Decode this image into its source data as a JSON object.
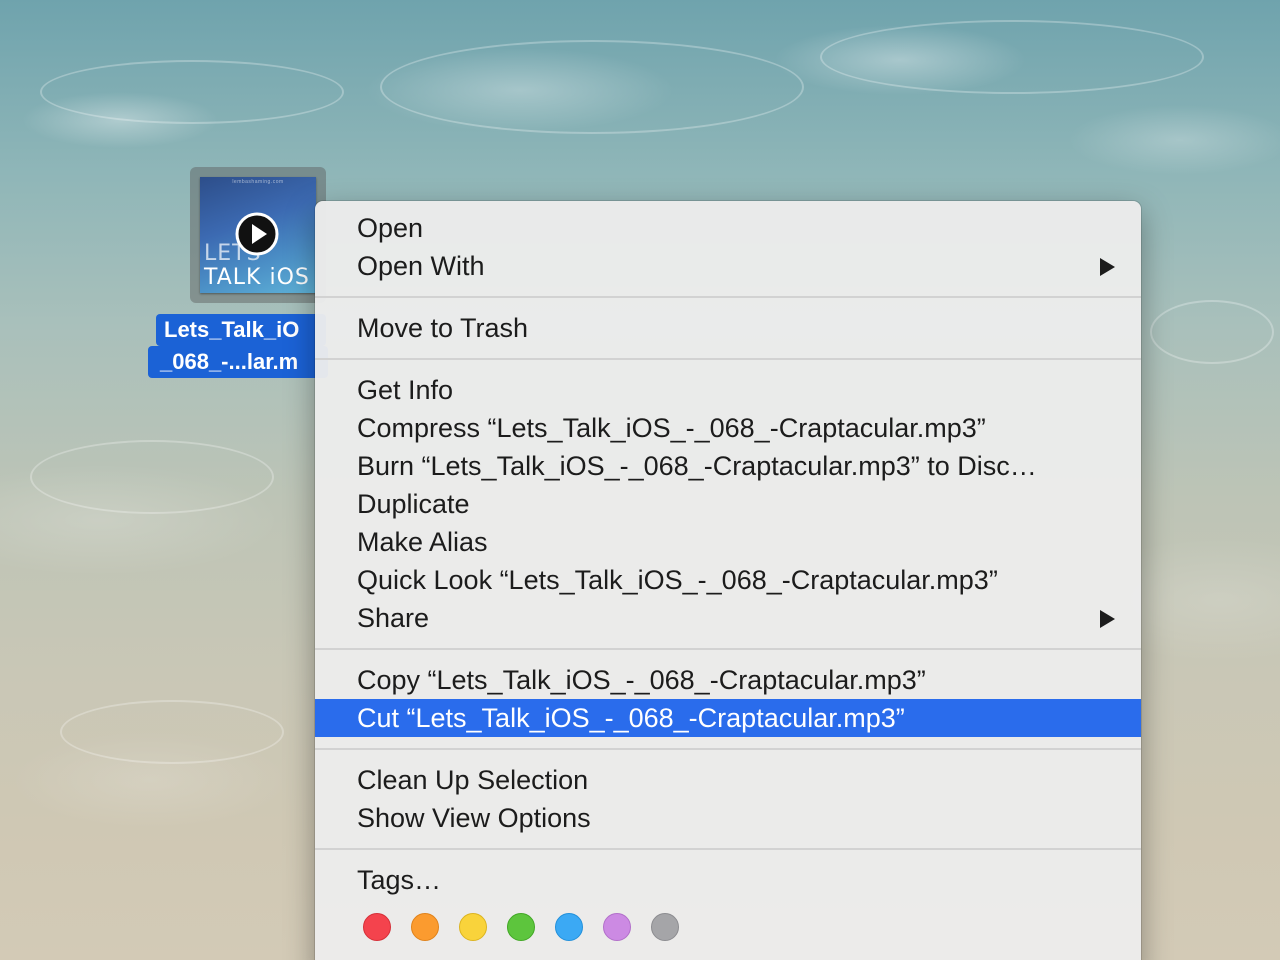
{
  "desktop_file": {
    "name_line1": "Lets_Talk_iO",
    "name_line2": "_068_-...lar.m",
    "thumbnail": {
      "line1": "LETS",
      "line2": "TALK iOS",
      "caption": "lembashaming.com",
      "badge_icon": "play-icon"
    }
  },
  "context_menu": {
    "groups": [
      [
        {
          "label": "Open",
          "submenu": false
        },
        {
          "label": "Open With",
          "submenu": true
        }
      ],
      [
        {
          "label": "Move to Trash",
          "submenu": false
        }
      ],
      [
        {
          "label": "Get Info",
          "submenu": false
        },
        {
          "label": "Compress “Lets_Talk_iOS_-_068_-Craptacular.mp3”",
          "submenu": false
        },
        {
          "label": "Burn “Lets_Talk_iOS_-_068_-Craptacular.mp3” to Disc…",
          "submenu": false
        },
        {
          "label": "Duplicate",
          "submenu": false
        },
        {
          "label": "Make Alias",
          "submenu": false
        },
        {
          "label": "Quick Look “Lets_Talk_iOS_-_068_-Craptacular.mp3”",
          "submenu": false
        },
        {
          "label": "Share",
          "submenu": true
        }
      ],
      [
        {
          "label": "Copy “Lets_Talk_iOS_-_068_-Craptacular.mp3”",
          "submenu": false
        },
        {
          "label": "Cut “Lets_Talk_iOS_-_068_-Craptacular.mp3”",
          "submenu": false,
          "highlighted": true
        }
      ],
      [
        {
          "label": "Clean Up Selection",
          "submenu": false
        },
        {
          "label": "Show View Options",
          "submenu": false
        }
      ],
      [
        {
          "label": "Tags…",
          "submenu": false
        }
      ]
    ],
    "tag_colors": [
      {
        "name": "red",
        "fill": "#f4434d",
        "border": "#d62f38"
      },
      {
        "name": "orange",
        "fill": "#fb9b2f",
        "border": "#e0821a"
      },
      {
        "name": "yellow",
        "fill": "#f9d33b",
        "border": "#dcb41f"
      },
      {
        "name": "green",
        "fill": "#5dc53d",
        "border": "#42a826"
      },
      {
        "name": "blue",
        "fill": "#3ba9f4",
        "border": "#2290db"
      },
      {
        "name": "purple",
        "fill": "#cc8ae3",
        "border": "#b26fca"
      },
      {
        "name": "gray",
        "fill": "#a5a5a8",
        "border": "#8c8c90"
      }
    ],
    "highlight_color": "#2a6cec"
  }
}
